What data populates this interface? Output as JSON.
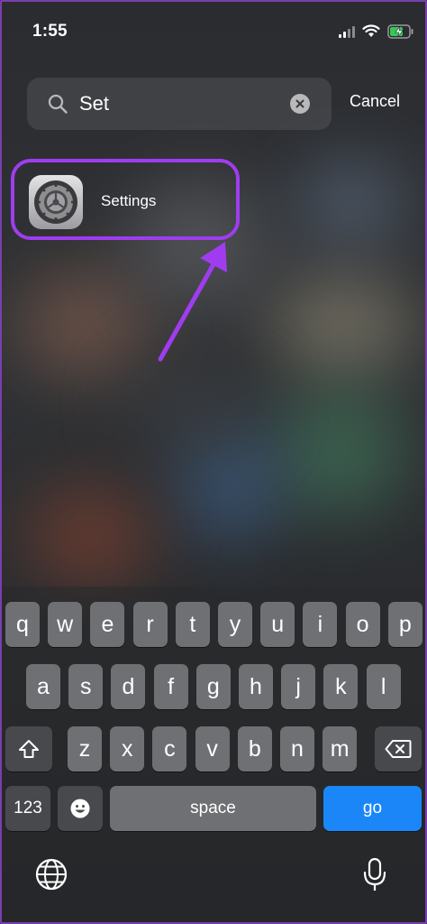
{
  "status_bar": {
    "time": "1:55"
  },
  "search": {
    "value": "Set",
    "cancel_label": "Cancel"
  },
  "results": [
    {
      "label": "Settings",
      "icon": "settings-gear-icon"
    }
  ],
  "keyboard": {
    "row1": [
      "q",
      "w",
      "e",
      "r",
      "t",
      "y",
      "u",
      "i",
      "o",
      "p"
    ],
    "row2": [
      "a",
      "s",
      "d",
      "f",
      "g",
      "h",
      "j",
      "k",
      "l"
    ],
    "row3": [
      "z",
      "x",
      "c",
      "v",
      "b",
      "n",
      "m"
    ],
    "numbers_label": "123",
    "space_label": "space",
    "go_label": "go"
  },
  "colors": {
    "highlight": "#a03cf0",
    "go_key": "#1a86f7"
  }
}
